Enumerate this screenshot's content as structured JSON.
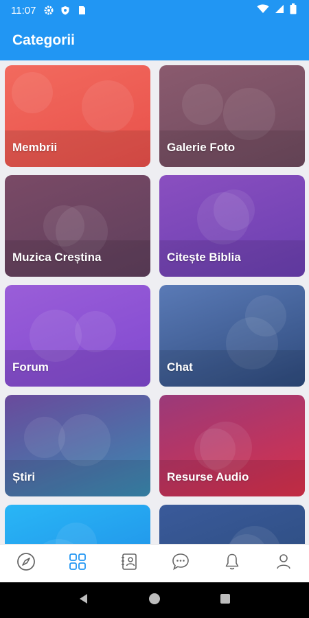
{
  "status_bar": {
    "time": "11:07",
    "icons": [
      "gear-icon",
      "shield-icon",
      "sim-card-icon",
      "wifi-icon",
      "signal-icon",
      "battery-icon"
    ]
  },
  "app_bar": {
    "title": "Categorii"
  },
  "colors": {
    "primary": "#2196f3",
    "nav_active": "#2196f3",
    "nav_inactive": "#666666"
  },
  "categories": [
    {
      "label": "Membrii",
      "gradient": [
        "#f26a5e",
        "#e8504a"
      ]
    },
    {
      "label": "Galerie Foto",
      "gradient": [
        "#8a5a6e",
        "#6e4a5e"
      ]
    },
    {
      "label": "Muzica Creștina",
      "gradient": [
        "#7a4a66",
        "#5e3f5c"
      ]
    },
    {
      "label": "Citește Biblia",
      "gradient": [
        "#8a4fc0",
        "#6a3fb0"
      ]
    },
    {
      "label": "Forum",
      "gradient": [
        "#9a5ed8",
        "#8048d0"
      ]
    },
    {
      "label": "Chat",
      "gradient": [
        "#5a7ab6",
        "#2e4a7c"
      ]
    },
    {
      "label": "Știri",
      "gradient": [
        "#6a4a9c",
        "#3a8ab0"
      ]
    },
    {
      "label": "Resurse Audio",
      "gradient": [
        "#9a3a7a",
        "#d8304a"
      ]
    },
    {
      "label": "",
      "gradient": [
        "#29b6f6",
        "#1e88e5"
      ]
    },
    {
      "label": "",
      "gradient": [
        "#3a5a9a",
        "#2a4a7a"
      ]
    }
  ],
  "bottom_nav": [
    {
      "name": "compass-icon",
      "active": false
    },
    {
      "name": "grid-icon",
      "active": true
    },
    {
      "name": "contacts-icon",
      "active": false
    },
    {
      "name": "chat-bubble-icon",
      "active": false
    },
    {
      "name": "bell-icon",
      "active": false
    },
    {
      "name": "person-icon",
      "active": false
    }
  ],
  "system_nav": [
    "back-icon",
    "home-icon",
    "recents-icon"
  ]
}
